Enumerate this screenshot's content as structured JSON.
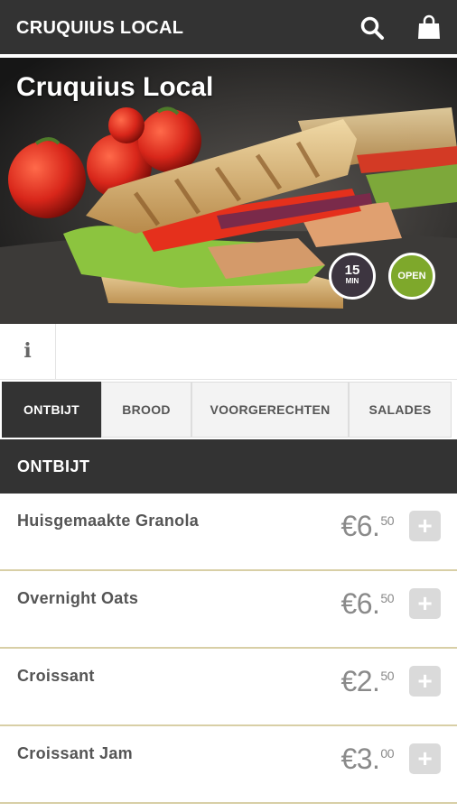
{
  "header": {
    "brand": "CRUQUIUS LOCAL",
    "search_icon": "search-icon",
    "bag_icon": "shopping-bag-icon"
  },
  "hero": {
    "title": "Cruquius Local",
    "delivery_time": "15",
    "delivery_unit": "MIN",
    "status": "OPEN",
    "status_color": "#7ea82b"
  },
  "info": {
    "icon": "info-icon",
    "label": "i"
  },
  "tabs": [
    {
      "label": "ONTBIJT",
      "active": true
    },
    {
      "label": "BROOD"
    },
    {
      "label": "VOORGERECHTEN"
    },
    {
      "label": "SALADES"
    }
  ],
  "section": {
    "title": "ONTBIJT"
  },
  "menu": [
    {
      "name": "Huisgemaakte Granola",
      "price_main": "€6.",
      "price_cents": "50",
      "add_label": "+"
    },
    {
      "name": "Overnight Oats",
      "price_main": "€6.",
      "price_cents": "50",
      "add_label": "+"
    },
    {
      "name": "Croissant",
      "price_main": "€2.",
      "price_cents": "50",
      "add_label": "+"
    },
    {
      "name": "Croissant Jam",
      "price_main": "€3.",
      "price_cents": "00",
      "add_label": "+"
    }
  ],
  "colors": {
    "header_bg": "#333333",
    "divider": "#d8cfa6",
    "price": "#8a8a8a"
  }
}
